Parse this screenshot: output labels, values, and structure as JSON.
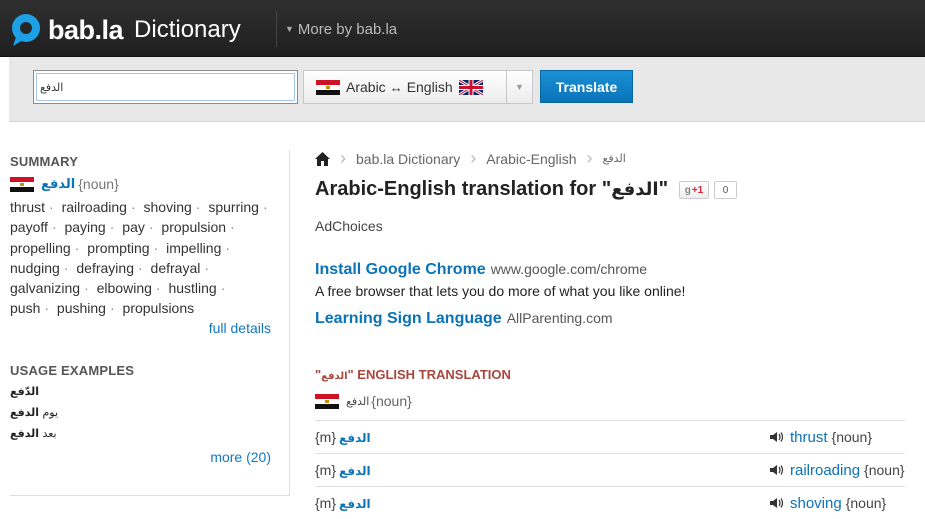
{
  "header": {
    "logo_text": "bab.la",
    "logo_suffix": "Dictionary",
    "more_by": "More by bab.la"
  },
  "search": {
    "value": "الدفع",
    "lang_from": "Arabic",
    "lang_arrow": "↔",
    "lang_to": "English",
    "translate_label": "Translate"
  },
  "sidebar": {
    "summary_heading": "SUMMARY",
    "term": "الدفع",
    "term_pos": "{noun}",
    "synonyms": [
      "thrust",
      "railroading",
      "shoving",
      "spurring",
      "payoff",
      "paying",
      "pay",
      "propulsion",
      "propelling",
      "prompting",
      "impelling",
      "nudging",
      "defraying",
      "defrayal",
      "galvanizing",
      "elbowing",
      "hustling",
      "push",
      "pushing",
      "propulsions"
    ],
    "full_details": "full details",
    "usage_heading": "USAGE EXAMPLES",
    "examples": [
      {
        "prefix": "",
        "bold": "الدّفع"
      },
      {
        "prefix": "يوم ",
        "bold": "الدفع"
      },
      {
        "prefix": "بعد ",
        "bold": "الدفع"
      }
    ],
    "more_label": "more (20)"
  },
  "main": {
    "breadcrumb": [
      "bab.la Dictionary",
      "Arabic-English",
      "الدفع"
    ],
    "title_prefix": "Arabic-English translation for \"",
    "title_term": "الدفع",
    "title_suffix": "\"",
    "gplus_label": "+1",
    "gplus_count": "0",
    "adchoices": "AdChoices",
    "ads": [
      {
        "title": "Install Google Chrome",
        "url": "www.google.com/chrome",
        "desc": "A free browser that lets you do more of what you like online!"
      },
      {
        "title": "Learning Sign Language",
        "url": "AllParenting.com",
        "desc": ""
      }
    ],
    "et_heading_quote_open": "\"",
    "et_heading_term": "الدفع",
    "et_heading_rest": "\" ENGLISH TRANSLATION",
    "et_term": "الدفع",
    "et_pos": "{noun}",
    "rows": [
      {
        "gender": "{m}",
        "arabic": "الدفع",
        "english": "thrust",
        "pos": "{noun}"
      },
      {
        "gender": "{m}",
        "arabic": "الدفع",
        "english": "railroading",
        "pos": "{noun}"
      },
      {
        "gender": "{m}",
        "arabic": "الدفع",
        "english": "shoving",
        "pos": "{noun}"
      }
    ]
  },
  "colors": {
    "topbar": "#262626",
    "accent_blue": "#0b73b8",
    "heading_red": "#a8473d"
  }
}
